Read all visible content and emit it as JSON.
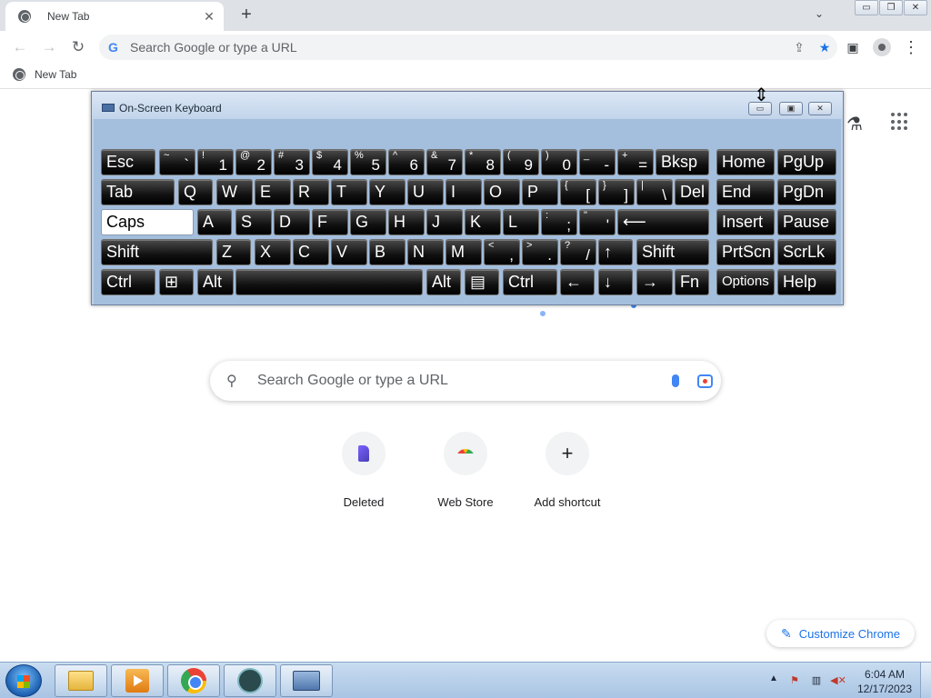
{
  "browser": {
    "tab_title": "New Tab",
    "tab_close": "✕",
    "new_tab": "+",
    "tab_search": "⌄",
    "window_controls": {
      "minimize": "▭",
      "restore": "❐",
      "close": "✕"
    }
  },
  "toolbar": {
    "back": "←",
    "forward": "→",
    "reload": "↻",
    "omnibox_placeholder": "Search Google or type a URL",
    "share_icon": "⇪",
    "bookmark_star": "★",
    "side_panel_icon": "▣",
    "menu_icon": "⋮"
  },
  "bookmarks": {
    "items": [
      {
        "label": "New Tab"
      }
    ]
  },
  "ntp": {
    "search_placeholder": "Search Google or type a URL",
    "search_icon": "🔍",
    "labs_icon": "⚗",
    "shortcuts": [
      {
        "label": "Deleted",
        "icon": "deleted-icon"
      },
      {
        "label": "Web Store",
        "icon": "webstore-icon"
      },
      {
        "label": "Add shortcut",
        "icon": "+"
      }
    ],
    "customize_label": "Customize Chrome",
    "customize_icon": "✎"
  },
  "osk": {
    "title": "On-Screen Keyboard",
    "controls": {
      "minimize": "▭",
      "restore": "▣",
      "close": "✕"
    },
    "rows": [
      [
        {
          "l": "Esc"
        },
        {
          "t": "~",
          "b": "`"
        },
        {
          "t": "!",
          "b": "1"
        },
        {
          "t": "@",
          "b": "2"
        },
        {
          "t": "#",
          "b": "3"
        },
        {
          "t": "$",
          "b": "4"
        },
        {
          "t": "%",
          "b": "5"
        },
        {
          "t": "^",
          "b": "6"
        },
        {
          "t": "&",
          "b": "7"
        },
        {
          "t": "*",
          "b": "8"
        },
        {
          "t": "(",
          "b": "9"
        },
        {
          "t": ")",
          "b": "0"
        },
        {
          "t": "_",
          "b": "-"
        },
        {
          "t": "+",
          "b": "="
        },
        {
          "l": "Bksp"
        },
        {
          "l": "Home"
        },
        {
          "l": "PgUp"
        }
      ],
      [
        {
          "l": "Tab"
        },
        {
          "l": "Q"
        },
        {
          "l": "W"
        },
        {
          "l": "E"
        },
        {
          "l": "R"
        },
        {
          "l": "T"
        },
        {
          "l": "Y"
        },
        {
          "l": "U"
        },
        {
          "l": "I"
        },
        {
          "l": "O"
        },
        {
          "l": "P"
        },
        {
          "t": "{",
          "b": "["
        },
        {
          "t": "}",
          "b": "]"
        },
        {
          "t": "|",
          "b": "\\"
        },
        {
          "l": "Del"
        },
        {
          "l": "End"
        },
        {
          "l": "PgDn"
        }
      ],
      [
        {
          "l": "Caps"
        },
        {
          "l": "A"
        },
        {
          "l": "S"
        },
        {
          "l": "D"
        },
        {
          "l": "F"
        },
        {
          "l": "G"
        },
        {
          "l": "H"
        },
        {
          "l": "J"
        },
        {
          "l": "K"
        },
        {
          "l": "L"
        },
        {
          "t": ":",
          "b": ";"
        },
        {
          "t": "\"",
          "b": "'"
        },
        {
          "l": "⟵"
        },
        {
          "l": "Insert"
        },
        {
          "l": "Pause"
        }
      ],
      [
        {
          "l": "Shift"
        },
        {
          "l": "Z"
        },
        {
          "l": "X"
        },
        {
          "l": "C"
        },
        {
          "l": "V"
        },
        {
          "l": "B"
        },
        {
          "l": "N"
        },
        {
          "l": "M"
        },
        {
          "t": "<",
          "b": ","
        },
        {
          "t": ">",
          "b": "."
        },
        {
          "t": "?",
          "b": "/"
        },
        {
          "l": "↑"
        },
        {
          "l": "Shift"
        },
        {
          "l": "PrtScn"
        },
        {
          "l": "ScrLk"
        }
      ],
      [
        {
          "l": "Ctrl"
        },
        {
          "l": "⊞"
        },
        {
          "l": "Alt"
        },
        {
          "l": ""
        },
        {
          "l": "Alt"
        },
        {
          "l": "▤"
        },
        {
          "l": "Ctrl"
        },
        {
          "l": "←"
        },
        {
          "l": "↓"
        },
        {
          "l": "→"
        },
        {
          "l": "Fn"
        },
        {
          "l": "Options"
        },
        {
          "l": "Help"
        }
      ]
    ],
    "caps_active": true
  },
  "taskbar": {
    "apps": [
      "file-explorer",
      "media-player",
      "chrome",
      "app",
      "on-screen-keyboard"
    ],
    "tray": {
      "expand": "▲",
      "time": "6:04 AM",
      "date": "12/17/2023"
    }
  },
  "colors": {
    "accent": "#1a73e8",
    "keyboard_bg": "#a4bedd",
    "taskbar": "#bcd2eb"
  }
}
